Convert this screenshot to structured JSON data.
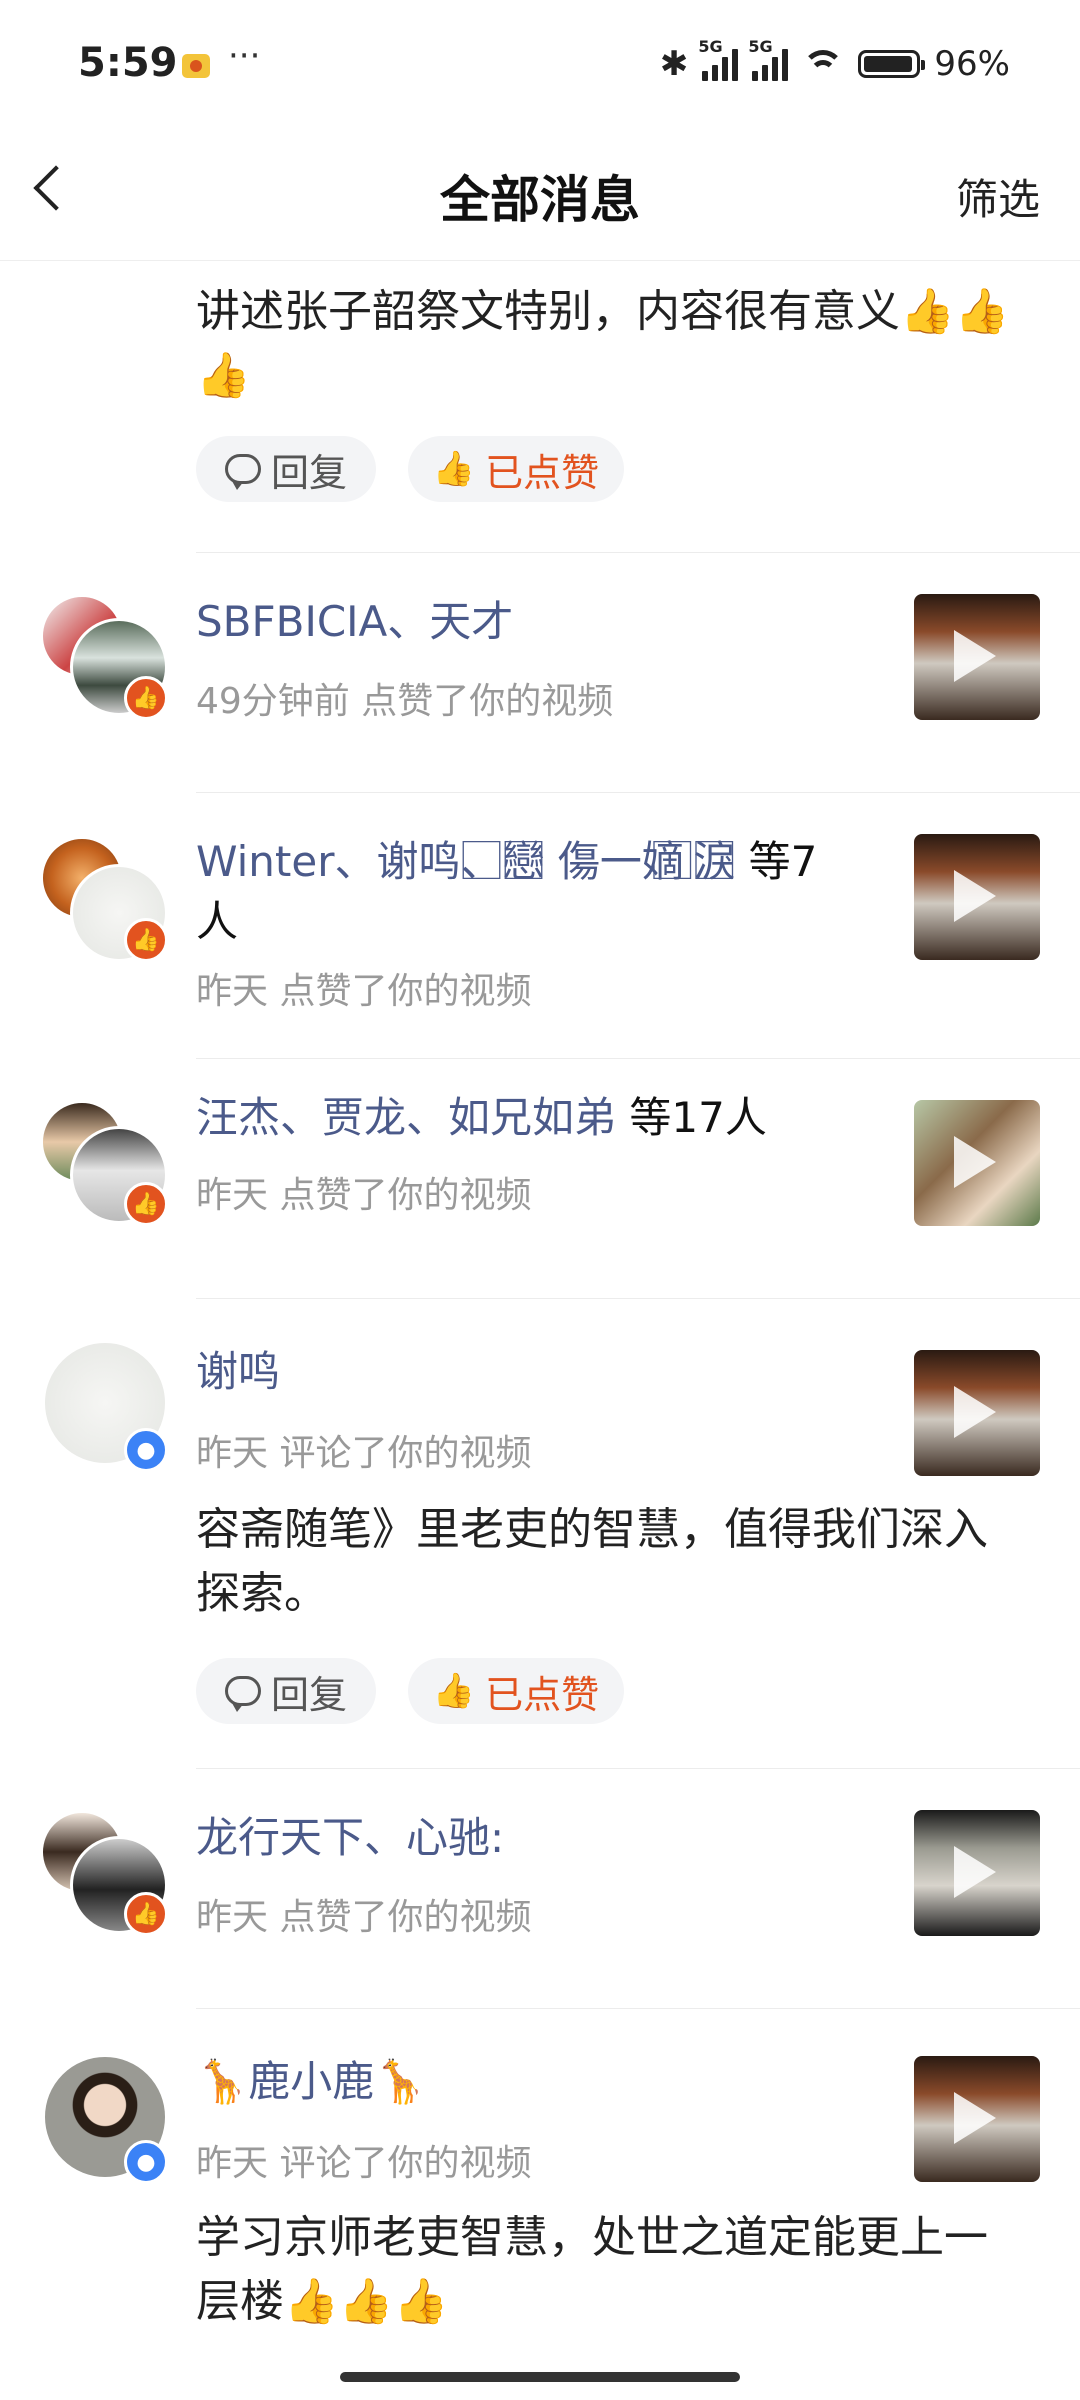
{
  "status_bar": {
    "time": "5:59",
    "dots": "···",
    "signal1": "5G",
    "signal2": "5G",
    "battery": "96%"
  },
  "header": {
    "title": "全部消息",
    "filter": "筛选"
  },
  "top_item": {
    "comment": "讲述张子韶祭文特别，内容很有意义👍👍👍",
    "reply_label": "回复",
    "liked_label": "已点赞"
  },
  "items": [
    {
      "names": "SBFBICIA、天才",
      "extra": "",
      "time": "49分钟前",
      "action": "点赞了你的视频"
    },
    {
      "names": "Winter、谢鸣、⃞戀⃞ 傷一嫡 ⃞淚⃞",
      "extra": "等7人",
      "time": "昨天",
      "action": "点赞了你的视频"
    },
    {
      "names": "汪杰、贾龙、如兄如弟",
      "extra": "等17人",
      "time": "昨天",
      "action": "点赞了你的视频"
    },
    {
      "names": "谢鸣",
      "extra": "",
      "time": "昨天",
      "action": "评论了你的视频",
      "comment": "容斋随笔》里老吏的智慧，值得我们深入探索。",
      "reply_label": "回复",
      "liked_label": "已点赞"
    },
    {
      "names": "龙行天下、心驰:",
      "extra": "",
      "time": "昨天",
      "action": "点赞了你的视频"
    },
    {
      "names": "🦒鹿小鹿🦒",
      "extra": "",
      "time": "昨天",
      "action": "评论了你的视频",
      "comment": "学习京师老吏智慧，处世之道定能更上一层楼👍👍👍"
    }
  ],
  "icons": {
    "back": "chevron-left-icon",
    "like_badge": "thumbs-up-icon",
    "comment_badge": "chat-bubble-icon",
    "play": "play-icon"
  },
  "colors": {
    "accent": "#e2531f",
    "name": "#4b5a8a",
    "meta": "#999999",
    "comment_badge": "#3b82f6"
  }
}
